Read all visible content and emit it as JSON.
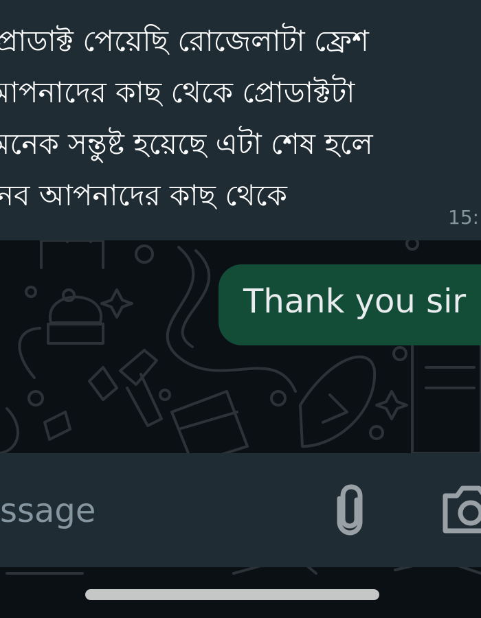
{
  "conversation": {
    "incoming_message": {
      "lines": [
        "প্রোডাক্ট পেয়েছি রোজেলাটা ফ্রেশ",
        "আপনাদের কাছ থেকে প্রোডাক্টটা",
        "অনেক সন্তুষ্ট হয়েছে এটা শেষ হলে",
        "নেব আপনাদের কাছ থেকে"
      ],
      "time": "15:"
    },
    "outgoing_message": {
      "text": "Thank you sir"
    }
  },
  "composer": {
    "placeholder": "ssage",
    "attach_icon": "paperclip-icon",
    "camera_icon": "camera-icon"
  },
  "colors": {
    "background": "#0b1014",
    "incoming_bubble": "#1f2c33",
    "outgoing_bubble": "#144d37",
    "secondary_text": "#8696a0"
  }
}
